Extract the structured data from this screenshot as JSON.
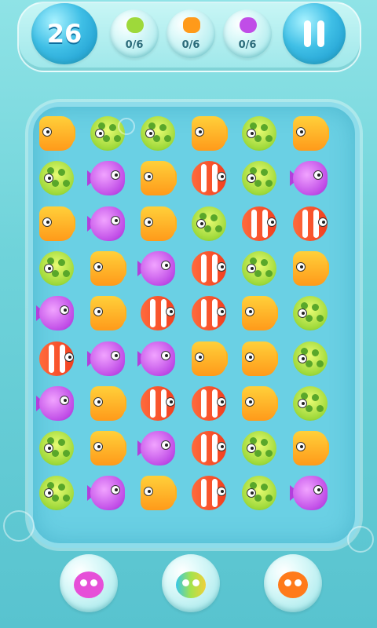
{
  "hud": {
    "moves": "26",
    "goals": [
      {
        "fish": "green-fish",
        "count": "0/6",
        "color": "#9ed93a"
      },
      {
        "fish": "orange-fish",
        "count": "0/6",
        "color": "#ff9a1a"
      },
      {
        "fish": "purple-fish",
        "count": "0/6",
        "color": "#c04de7"
      }
    ],
    "pause_icon": "pause-icon"
  },
  "board": {
    "rows": 9,
    "cols": 6,
    "tiles": [
      [
        "orange",
        "green",
        "green",
        "orange",
        "green",
        "orange"
      ],
      [
        "green",
        "purple",
        "orange",
        "red",
        "green",
        "purple"
      ],
      [
        "orange",
        "purple",
        "orange",
        "green",
        "red",
        "red"
      ],
      [
        "green",
        "orange",
        "purple",
        "red",
        "green",
        "orange"
      ],
      [
        "purple",
        "orange",
        "red",
        "red",
        "orange",
        "green"
      ],
      [
        "red",
        "purple",
        "purple",
        "orange",
        "orange",
        "green"
      ],
      [
        "purple",
        "orange",
        "red",
        "red",
        "orange",
        "green"
      ],
      [
        "green",
        "orange",
        "purple",
        "red",
        "green",
        "orange"
      ],
      [
        "green",
        "purple",
        "orange",
        "red",
        "green",
        "purple"
      ]
    ]
  },
  "powerups": [
    {
      "name": "pink-creature-powerup",
      "color": "#e64fd8"
    },
    {
      "name": "rainbow-creature-powerup",
      "color": "#36c6e8"
    },
    {
      "name": "orange-creature-powerup",
      "color": "#ff7a1a"
    }
  ]
}
